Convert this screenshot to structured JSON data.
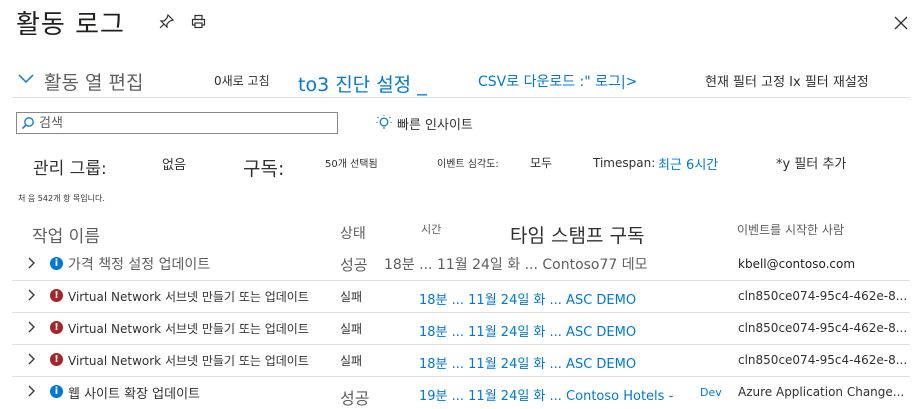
{
  "header": {
    "title": "활동 로그"
  },
  "toolbar": {
    "edit_columns": "활동 열 편집",
    "refresh": "0새로 고침",
    "diagnostic": "to3 진단 설정 _",
    "csv": "CSV로 다운로드 :\" 로그|>",
    "pin_filter": "현재 필터 고정 Ix 필터 재설정"
  },
  "search": {
    "placeholder": "검색",
    "quick_insights": "빠른 인사이트"
  },
  "filters": {
    "mgmt_group_label": "관리 그룹:",
    "mgmt_group_value": "없음",
    "subscription_label": "구독:",
    "subscription_value": "50개 선택됨",
    "severity_label": "이벤트 심각도:",
    "severity_value": "모두",
    "timespan_label": "Timespan:",
    "timespan_value": "최근 6시간",
    "add_filter": "*y 필터 추가"
  },
  "result_count": "처 음 542개 항 목입니다.",
  "table": {
    "headers": {
      "operation": "작업 이름",
      "status": "상태",
      "time": "시간",
      "timestamp_subscription": "타임 스탬프 구독",
      "initiated_by": "이벤트를 시작한 사람"
    },
    "rows": [
      {
        "severity": "info",
        "operation": "가격 책정 설정 업데이트",
        "status": "성공",
        "time": "18분 ... 11월 24일 화 ... Contoso77 데모",
        "initiated_by": "kbell@contoso.com"
      },
      {
        "severity": "error",
        "operation": "Virtual Network 서브넷 만들기 또는 업데이트",
        "status": "실패",
        "time": "18분 ... 11월 24일 화 ... ASC DEMO",
        "initiated_by": "cln850ce074-95c4-462e-8..."
      },
      {
        "severity": "error",
        "operation": "Virtual Network 서브넷 만들기 또는 업데이트",
        "status": "실패",
        "time": "18분 ... 11월 24일 화 ... ASC DEMO",
        "initiated_by": "cln850ce074-95c4-462e-8..."
      },
      {
        "severity": "error",
        "operation": "Virtual Network 서브넷 만들기 또는 업데이트",
        "status": "실패",
        "time": "18분 ... 11월 24일 화 ... ASC DEMO",
        "initiated_by": "cln850ce074-95c4-462e-8..."
      },
      {
        "severity": "info",
        "operation": "웹 사이트 확장 업데이트",
        "status": "성공",
        "time": "19분 ... 11월 24일 화 ... Contoso Hotels -",
        "time_suffix": "Dev",
        "initiated_by": "Azure Application Change..."
      }
    ]
  },
  "colors": {
    "accent": "#0078d4",
    "error": "#a4262c",
    "text": "#323130",
    "muted": "#605e5c",
    "divider": "#e1dfdd"
  },
  "icons": [
    "pin-icon",
    "print-icon",
    "close-icon",
    "chevron-down-icon",
    "search-icon",
    "lightbulb-icon",
    "chevron-right-icon",
    "info-icon",
    "error-icon"
  ]
}
